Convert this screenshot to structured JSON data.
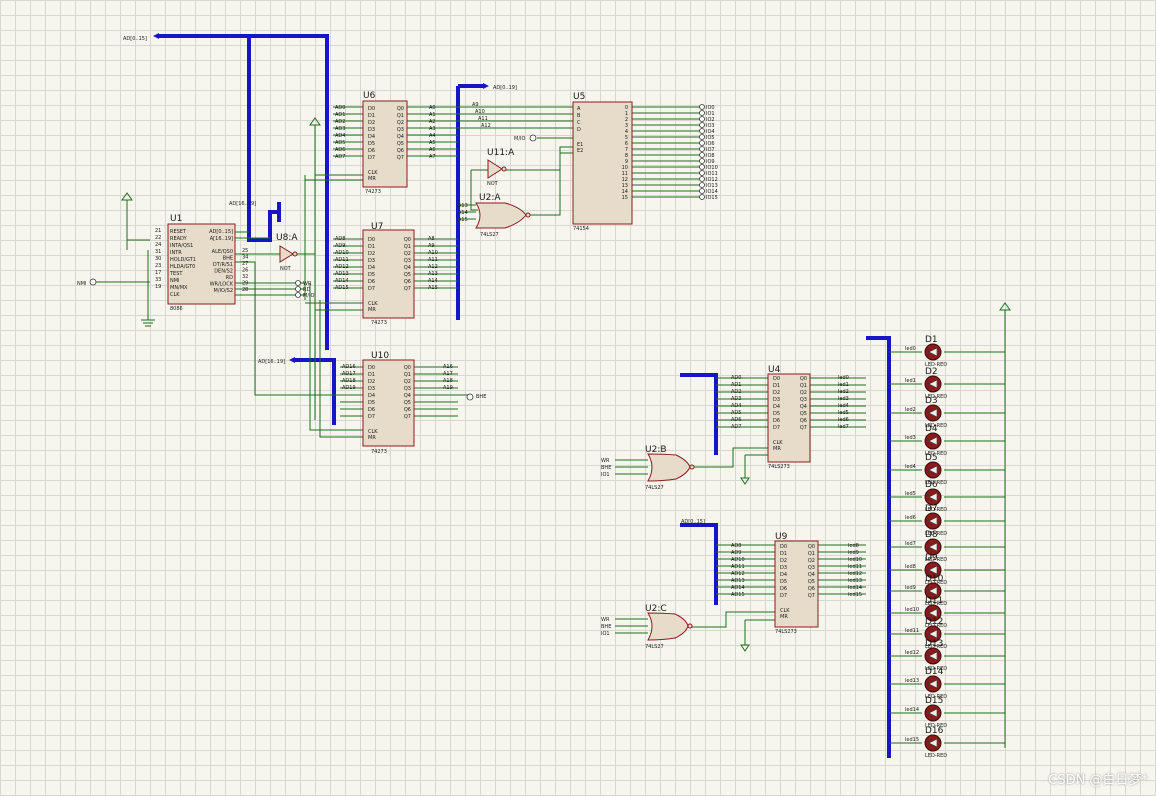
{
  "chips": {
    "u1": {
      "ref": "U1",
      "part": "8086",
      "left_pins": [
        [
          "21",
          "RESET"
        ],
        [
          "22",
          "READY"
        ],
        [
          "24",
          "INTA/QS1"
        ],
        [
          "31",
          "INTR"
        ],
        [
          "30",
          "HOLD/GT1"
        ],
        [
          "23",
          "HLDA/GT0"
        ],
        [
          "17",
          "TEST"
        ],
        [
          "33",
          "NMI"
        ],
        [
          "19",
          "MN/MX"
        ],
        [
          "",
          "CLK"
        ]
      ],
      "right_pins": [
        [
          "",
          "AD[0..15]"
        ],
        [
          "",
          "A[16..19]"
        ],
        [
          "25",
          "ALE/QS0"
        ],
        [
          "34",
          "BHE"
        ],
        [
          "27",
          "DT/R/S1"
        ],
        [
          "26",
          "DEN/S2"
        ],
        [
          "32",
          "RD"
        ],
        [
          "29",
          "WR/LOCK"
        ],
        [
          "28",
          "M/IO/S2"
        ]
      ]
    },
    "u6": {
      "ref": "U6",
      "part": "74273"
    },
    "u7": {
      "ref": "U7",
      "part": "74273"
    },
    "u10": {
      "ref": "U10",
      "part": "74273"
    },
    "u5": {
      "ref": "U5",
      "part": "74154"
    },
    "u4": {
      "ref": "U4",
      "part": "74LS273"
    },
    "u9": {
      "ref": "U9",
      "part": "74LS273"
    },
    "u8": {
      "ref": "U8:A",
      "part": "NOT"
    },
    "u11": {
      "ref": "U11:A",
      "part": "NOT"
    },
    "u2a": {
      "ref": "U2:A",
      "part": "74LS27"
    },
    "u2b": {
      "ref": "U2:B",
      "part": "74LS27"
    },
    "u2c": {
      "ref": "U2:C",
      "part": "74LS27"
    }
  },
  "latch_pins": [
    "D0",
    "D1",
    "D2",
    "D3",
    "D4",
    "D5",
    "D6",
    "D7"
  ],
  "latch_out": [
    "Q0",
    "Q1",
    "Q2",
    "Q3",
    "Q4",
    "Q5",
    "Q6",
    "Q7"
  ],
  "latch_ctrl": [
    "CLK",
    "MR"
  ],
  "u6_in": [
    "AD0",
    "AD1",
    "AD2",
    "AD3",
    "AD4",
    "AD5",
    "AD6",
    "AD7"
  ],
  "u6_out": [
    "A0",
    "A1",
    "A2",
    "A3",
    "A4",
    "A5",
    "A6",
    "A7"
  ],
  "u7_in": [
    "AD8",
    "AD9",
    "AD10",
    "AD11",
    "AD12",
    "AD13",
    "AD14",
    "AD15"
  ],
  "u7_out": [
    "A8",
    "A9",
    "A10",
    "A11",
    "A12",
    "A13",
    "A14",
    "A15"
  ],
  "u10_in": [
    "AD16",
    "AD17",
    "AD18",
    "AD19",
    "",
    "",
    "",
    ""
  ],
  "u10_out": [
    "A16",
    "A17",
    "A18",
    "A19",
    "",
    "",
    "",
    ""
  ],
  "u4_in": [
    "AD0",
    "AD1",
    "AD2",
    "AD3",
    "AD4",
    "AD5",
    "AD6",
    "AD7"
  ],
  "u4_out": [
    "led0",
    "led1",
    "led2",
    "led3",
    "led4",
    "led5",
    "led6",
    "led7"
  ],
  "u9_in": [
    "AD8",
    "AD9",
    "AD10",
    "AD11",
    "AD12",
    "AD13",
    "AD14",
    "AD15"
  ],
  "u9_out": [
    "led8",
    "led9",
    "led10",
    "led11",
    "led12",
    "led13",
    "led14",
    "led15"
  ],
  "u5_in": [
    "A",
    "B",
    "C",
    "D",
    "E1",
    "E2"
  ],
  "u5_in_nets": [
    "A9",
    "A10",
    "A11",
    "A12"
  ],
  "u5_out": [
    "0",
    "1",
    "2",
    "3",
    "4",
    "5",
    "6",
    "7",
    "8",
    "9",
    "10",
    "11",
    "12",
    "13",
    "14",
    "15"
  ],
  "io_labels": [
    "IO0",
    "IO1",
    "IO2",
    "IO3",
    "IO4",
    "IO5",
    "IO6",
    "IO7",
    "IO8",
    "IO9",
    "IO10",
    "IO11",
    "IO12",
    "IO13",
    "IO14",
    "IO15"
  ],
  "net_labels": {
    "ad_top": "AD[0..15]",
    "ad_bus2": "AD[0..19]",
    "ad1619_a": "AD[16..19]",
    "ad1619_b": "AD[16..19]",
    "ad015_u9": "AD[0..15]",
    "mio": "M/IO",
    "bhe": "BHE",
    "nmi": "NMI",
    "wr": "WR",
    "rd": "RD",
    "io1": "IO1",
    "u2a_in": [
      "A13",
      "A14",
      "A15"
    ],
    "gate_in_b": [
      "WR",
      "BHE",
      "IO1"
    ],
    "gate_in_c": [
      "WR",
      "BHE",
      "IO1"
    ],
    "u1_side": [
      "WR",
      "RD",
      "M/IO"
    ]
  },
  "leds": {
    "refs": [
      "D1",
      "D2",
      "D3",
      "D4",
      "D5",
      "D6",
      "D7",
      "D8",
      "D9",
      "D10",
      "D11",
      "D12",
      "D13",
      "D14",
      "D15",
      "D16"
    ],
    "part": "LED-RED",
    "nets": [
      "led0",
      "led1",
      "led2",
      "led3",
      "led4",
      "led5",
      "led6",
      "led7",
      "led8",
      "led9",
      "led10",
      "led11",
      "led12",
      "led13",
      "led14",
      "led15"
    ]
  },
  "watermark": "CSDN @白日梦*"
}
